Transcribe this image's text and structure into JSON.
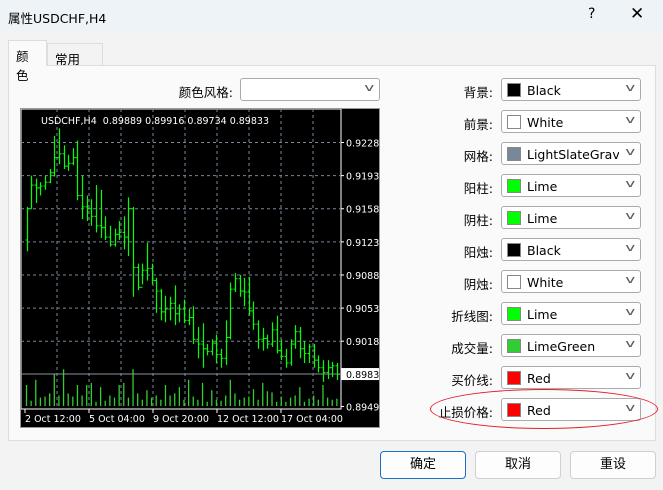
{
  "window": {
    "title": "属性USDCHF,H4",
    "help": "?",
    "close": "✕"
  },
  "tabs": [
    {
      "label": "颜色",
      "active": true
    },
    {
      "label": "常用",
      "active": false
    }
  ],
  "color_scheme": {
    "label": "颜色风格:",
    "value": ""
  },
  "colors": [
    {
      "label": "背景:",
      "value": "Black",
      "swatch": "#000000"
    },
    {
      "label": "前景:",
      "value": "White",
      "swatch": "#ffffff"
    },
    {
      "label": "网格:",
      "value": "LightSlateGrav",
      "swatch": "#778899"
    },
    {
      "label": "阳柱:",
      "value": "Lime",
      "swatch": "#00ff00"
    },
    {
      "label": "阴柱:",
      "value": "Lime",
      "swatch": "#00ff00"
    },
    {
      "label": "阳烛:",
      "value": "Black",
      "swatch": "#000000"
    },
    {
      "label": "阴烛:",
      "value": "White",
      "swatch": "#ffffff"
    },
    {
      "label": "折线图:",
      "value": "Lime",
      "swatch": "#00ff00"
    },
    {
      "label": "成交量:",
      "value": "LimeGreen",
      "swatch": "#32cd32"
    },
    {
      "label": "买价线:",
      "value": "Red",
      "swatch": "#ff0000"
    },
    {
      "label": "止损价格:",
      "value": "Red",
      "swatch": "#ff0000"
    }
  ],
  "buttons": {
    "ok": "确定",
    "cancel": "取消",
    "reset": "重设"
  },
  "chart_data": {
    "type": "ohlc",
    "header": "USDCHF,H4  0.89889 0.89916 0.89734 0.89833",
    "ylim": [
      0.8949,
      0.9228
    ],
    "y_ticks": [
      "0.92280",
      "0.91930",
      "0.91580",
      "0.91230",
      "0.90880",
      "0.90530",
      "0.90180",
      "0.89490"
    ],
    "current_price": "0.89833",
    "x_ticks": [
      "2 Oct 12:00",
      "5 Oct 04:00",
      "9 Oct 20:00",
      "12 Oct 12:00",
      "17 Oct 04:00"
    ],
    "grid": true,
    "open": [
      0.9125,
      0.9158,
      0.9183,
      0.918,
      0.9182,
      0.9186,
      0.9196,
      0.9212,
      0.9216,
      0.9203,
      0.9206,
      0.9212,
      0.9172,
      0.916,
      0.9158,
      0.915,
      0.914,
      0.9138,
      0.9128,
      0.912,
      0.9131,
      0.9133,
      0.9128,
      0.9158,
      0.9096,
      0.9075,
      0.9093,
      0.9095,
      0.9082,
      0.9071,
      0.9049,
      0.9052,
      0.9058,
      0.9047,
      0.9052,
      0.904,
      0.9043,
      0.902,
      0.9015,
      0.901,
      0.9007,
      0.9016,
      0.9004,
      0.9,
      0.9022,
      0.9073,
      0.9084,
      0.9071,
      0.907,
      0.905,
      0.9036,
      0.902,
      0.9021,
      0.9015,
      0.903,
      0.9008,
      0.9002,
      0.8995,
      0.9015,
      0.9028,
      0.901,
      0.9005,
      0.9012,
      0.8998,
      0.899,
      0.8985,
      0.899,
      0.8992
    ],
    "high": [
      0.916,
      0.9193,
      0.919,
      0.9186,
      0.9193,
      0.92,
      0.9235,
      0.9243,
      0.9225,
      0.9215,
      0.9222,
      0.923,
      0.9193,
      0.9172,
      0.9168,
      0.9183,
      0.9178,
      0.915,
      0.914,
      0.9137,
      0.9145,
      0.915,
      0.917,
      0.916,
      0.91,
      0.91,
      0.9122,
      0.91,
      0.9085,
      0.9073,
      0.9066,
      0.9065,
      0.9077,
      0.9057,
      0.9062,
      0.9052,
      0.9055,
      0.9033,
      0.9037,
      0.9015,
      0.902,
      0.9025,
      0.901,
      0.904,
      0.908,
      0.909,
      0.9088,
      0.9085,
      0.9086,
      0.906,
      0.904,
      0.9032,
      0.9025,
      0.9038,
      0.9045,
      0.902,
      0.901,
      0.902,
      0.9035,
      0.9033,
      0.9018,
      0.9015,
      0.9015,
      0.9003,
      0.8998,
      0.8998,
      0.8996,
      0.8995
    ],
    "low": [
      0.9113,
      0.9158,
      0.9164,
      0.9172,
      0.9178,
      0.9185,
      0.9192,
      0.9205,
      0.92,
      0.9198,
      0.9204,
      0.9167,
      0.9147,
      0.9145,
      0.914,
      0.9133,
      0.9127,
      0.9125,
      0.9118,
      0.9118,
      0.9125,
      0.9115,
      0.9108,
      0.9065,
      0.9072,
      0.9078,
      0.9082,
      0.9078,
      0.9048,
      0.904,
      0.9038,
      0.904,
      0.9035,
      0.9038,
      0.9037,
      0.9035,
      0.9015,
      0.9,
      0.899,
      0.9003,
      0.9003,
      0.8995,
      0.899,
      0.8993,
      0.902,
      0.907,
      0.9065,
      0.9055,
      0.9045,
      0.903,
      0.901,
      0.9008,
      0.901,
      0.9012,
      0.9005,
      0.8998,
      0.899,
      0.8992,
      0.901,
      0.9,
      0.8995,
      0.8995,
      0.899,
      0.8985,
      0.8975,
      0.8978,
      0.898,
      0.8977
    ],
    "close": [
      0.9158,
      0.9183,
      0.918,
      0.9182,
      0.9186,
      0.9196,
      0.9212,
      0.9216,
      0.9203,
      0.9206,
      0.9212,
      0.9172,
      0.916,
      0.9158,
      0.915,
      0.914,
      0.9138,
      0.9128,
      0.912,
      0.9131,
      0.9133,
      0.9128,
      0.9158,
      0.9096,
      0.9075,
      0.9093,
      0.9095,
      0.9082,
      0.9071,
      0.9049,
      0.9052,
      0.9058,
      0.9047,
      0.9052,
      0.904,
      0.9043,
      0.902,
      0.9015,
      0.901,
      0.9007,
      0.9016,
      0.9004,
      0.9,
      0.9022,
      0.9073,
      0.9084,
      0.9071,
      0.907,
      0.905,
      0.9036,
      0.902,
      0.9021,
      0.9015,
      0.903,
      0.9008,
      0.9002,
      0.8995,
      0.9015,
      0.9028,
      0.901,
      0.9005,
      0.9012,
      0.8998,
      0.899,
      0.8985,
      0.899,
      0.8992,
      0.8983
    ],
    "volume": [
      20,
      5,
      25,
      8,
      9,
      12,
      30,
      10,
      35,
      12,
      9,
      20,
      10,
      20,
      22,
      4,
      18,
      5,
      10,
      8,
      20,
      22,
      8,
      35,
      12,
      6,
      15,
      8,
      10,
      6,
      20,
      10,
      12,
      18,
      6,
      25,
      9,
      6,
      22,
      4,
      15,
      6,
      5,
      10,
      25,
      12,
      6,
      8,
      9,
      16,
      6,
      22,
      14,
      13,
      4,
      9,
      4,
      8,
      10,
      18,
      4,
      7,
      10,
      6,
      20,
      8,
      6,
      7
    ],
    "colors": {
      "background": "#000000",
      "foreground": "#ffffff",
      "grid": "#778899",
      "bar": "#00ff00",
      "volume": "#32cd32"
    }
  }
}
